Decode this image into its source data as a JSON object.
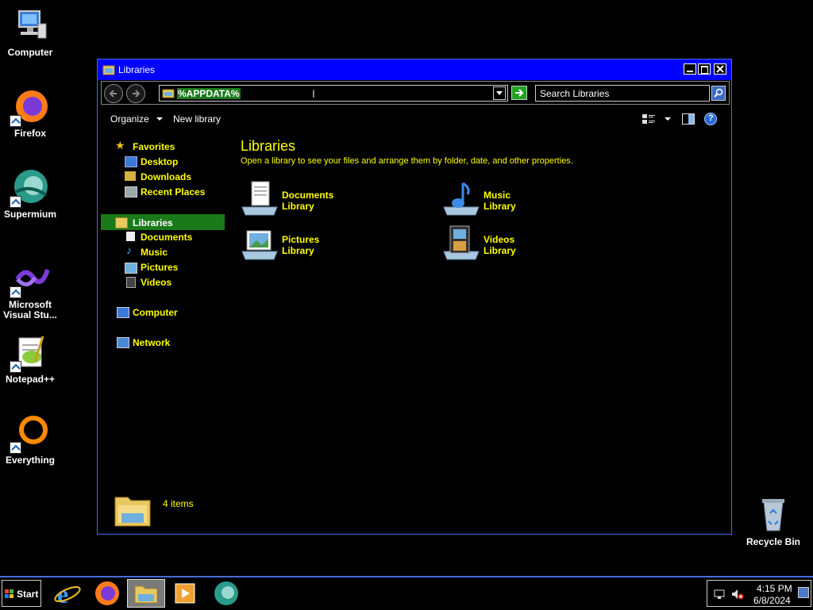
{
  "desktop": {
    "icons": [
      {
        "label": "Computer"
      },
      {
        "label": "Firefox"
      },
      {
        "label": "Supermium"
      },
      {
        "label": "Microsoft Visual Stu..."
      },
      {
        "label": "Notepad++"
      },
      {
        "label": "Everything"
      },
      {
        "label": "Recycle Bin"
      }
    ]
  },
  "window": {
    "title": "Libraries",
    "address": "%APPDATA%",
    "search_placeholder": "Search Libraries",
    "toolbar": {
      "organize": "Organize",
      "new_library": "New library"
    },
    "nav": {
      "favorites": "Favorites",
      "favorites_items": [
        "Desktop",
        "Downloads",
        "Recent Places"
      ],
      "libraries": "Libraries",
      "libraries_items": [
        "Documents",
        "Music",
        "Pictures",
        "Videos"
      ],
      "computer": "Computer",
      "network": "Network"
    },
    "content": {
      "heading": "Libraries",
      "subtitle": "Open a library to see your files and arrange them by folder, date, and other properties.",
      "libraries": [
        {
          "name": "Documents",
          "type": "Library"
        },
        {
          "name": "Music",
          "type": "Library"
        },
        {
          "name": "Pictures",
          "type": "Library"
        },
        {
          "name": "Videos",
          "type": "Library"
        }
      ]
    },
    "status": "4 items"
  },
  "taskbar": {
    "start": "Start",
    "clock_time": "4:15 PM",
    "clock_date": "6/8/2024"
  },
  "colors": {
    "title_bar": "#0000ff",
    "nav_text": "#ffff00",
    "selection": "#1a7a1a"
  }
}
